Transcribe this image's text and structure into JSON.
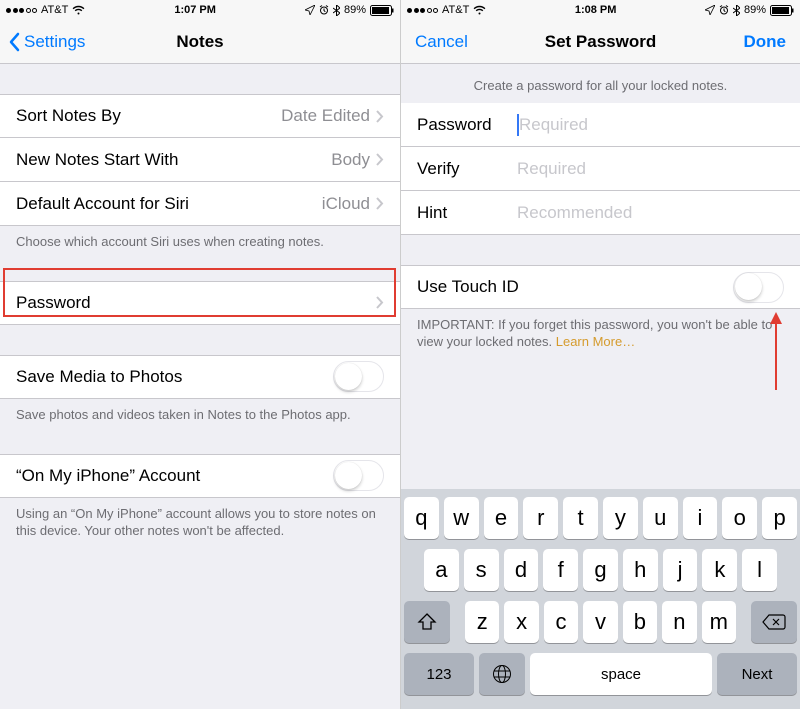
{
  "left": {
    "statusbar": {
      "carrier": "AT&T",
      "time": "1:07 PM",
      "battery": "89%"
    },
    "nav": {
      "back": "Settings",
      "title": "Notes"
    },
    "rows": {
      "sort": {
        "label": "Sort Notes By",
        "value": "Date Edited"
      },
      "start": {
        "label": "New Notes Start With",
        "value": "Body"
      },
      "siri": {
        "label": "Default Account for Siri",
        "value": "iCloud"
      },
      "siri_footer": "Choose which account Siri uses when creating notes.",
      "password": {
        "label": "Password"
      },
      "savemedia": {
        "label": "Save Media to Photos"
      },
      "savemedia_footer": "Save photos and videos taken in Notes to the Photos app.",
      "onmyiphone": {
        "label": "“On My iPhone” Account"
      },
      "onmyiphone_footer": "Using an “On My iPhone” account allows you to store notes on this device. Your other notes won't be affected."
    }
  },
  "right": {
    "statusbar": {
      "carrier": "AT&T",
      "time": "1:08 PM",
      "battery": "89%"
    },
    "nav": {
      "cancel": "Cancel",
      "title": "Set Password",
      "done": "Done"
    },
    "header": "Create a password for all your locked notes.",
    "fields": {
      "password": {
        "label": "Password",
        "placeholder": "Required"
      },
      "verify": {
        "label": "Verify",
        "placeholder": "Required"
      },
      "hint": {
        "label": "Hint",
        "placeholder": "Recommended"
      }
    },
    "touchid": {
      "label": "Use Touch ID"
    },
    "important": "IMPORTANT: If you forget this password, you won't be able to view your locked notes. ",
    "learn_more": "Learn More…",
    "keyboard": {
      "row1": [
        "q",
        "w",
        "e",
        "r",
        "t",
        "y",
        "u",
        "i",
        "o",
        "p"
      ],
      "row2": [
        "a",
        "s",
        "d",
        "f",
        "g",
        "h",
        "j",
        "k",
        "l"
      ],
      "row3": [
        "z",
        "x",
        "c",
        "v",
        "b",
        "n",
        "m"
      ],
      "num": "123",
      "space": "space",
      "next": "Next"
    }
  }
}
